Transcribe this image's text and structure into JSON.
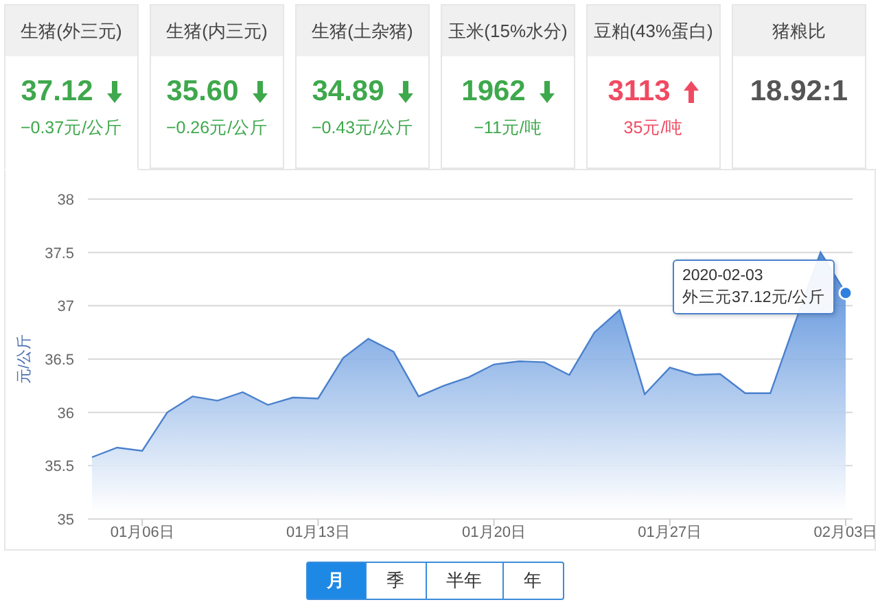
{
  "cards": [
    {
      "title": "生猪(外三元)",
      "value": "37.12",
      "change": "−0.37元/公斤",
      "kind": "down",
      "selected": true
    },
    {
      "title": "生猪(内三元)",
      "value": "35.60",
      "change": "−0.26元/公斤",
      "kind": "down",
      "selected": false
    },
    {
      "title": "生猪(土杂猪)",
      "value": "34.89",
      "change": "−0.43元/公斤",
      "kind": "down",
      "selected": false
    },
    {
      "title": "玉米(15%水分)",
      "value": "1962",
      "change": "−11元/吨",
      "kind": "down",
      "selected": false
    },
    {
      "title": "豆粕(43%蛋白)",
      "value": "3113",
      "change": "35元/吨",
      "kind": "up",
      "selected": false
    },
    {
      "title": "猪粮比",
      "value": "18.92:1",
      "kind": "flat",
      "selected": false
    }
  ],
  "chart": {
    "chart_data": {
      "type": "area",
      "ylabel": "元/公斤",
      "grid": true,
      "categories": [
        null,
        null,
        "01月06日",
        null,
        null,
        null,
        null,
        null,
        null,
        "01月13日",
        null,
        null,
        null,
        null,
        null,
        null,
        "01月20日",
        null,
        null,
        null,
        null,
        null,
        null,
        "01月27日",
        null,
        null,
        null,
        null,
        null,
        null,
        "02月03日"
      ],
      "series": [
        {
          "color": "#4a80cc",
          "values": [
            35.58,
            35.67,
            35.64,
            36.0,
            36.15,
            36.11,
            36.19,
            36.07,
            36.14,
            36.13,
            36.51,
            36.69,
            36.57,
            36.15,
            36.25,
            36.33,
            36.45,
            36.48,
            36.47,
            36.35,
            36.75,
            36.96,
            36.17,
            36.42,
            36.35,
            36.36,
            36.18,
            36.18,
            36.85,
            37.5,
            37.12
          ]
        }
      ],
      "ylim": [
        35,
        38
      ],
      "yticks": [
        35,
        35.5,
        36,
        36.5,
        37,
        37.5,
        38
      ]
    },
    "tooltip": {
      "date": "2020-02-03",
      "text": "外三元37.12元/公斤"
    }
  },
  "periods": [
    {
      "label": "月",
      "selected": true
    },
    {
      "label": "季",
      "selected": false
    },
    {
      "label": "半年",
      "selected": false
    },
    {
      "label": "年",
      "selected": false
    }
  ]
}
